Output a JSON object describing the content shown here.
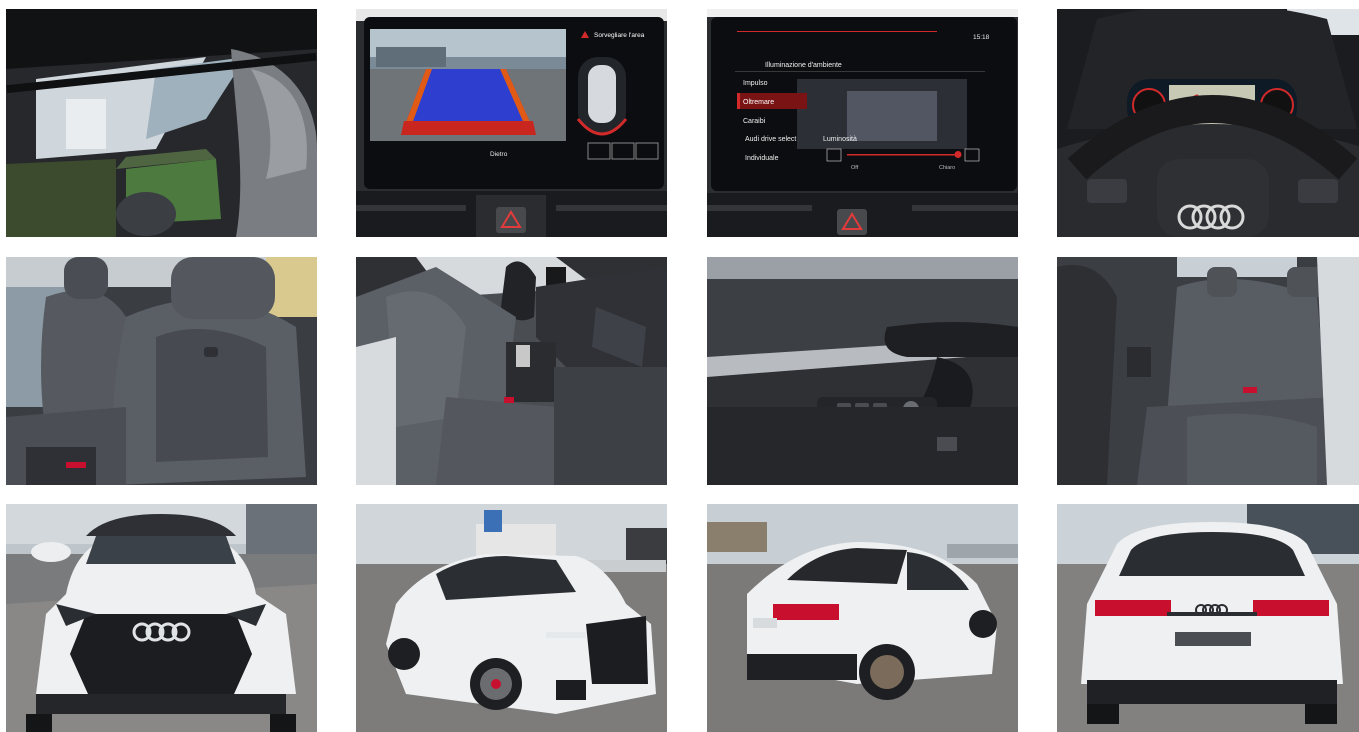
{
  "gallery": {
    "photos": [
      {
        "subject": "panoramic-sunroof-interior"
      },
      {
        "subject": "rear-camera-display",
        "screen": {
          "warning": "Sorvegliare l'area",
          "view": "Dietro"
        }
      },
      {
        "subject": "ambient-lighting-menu",
        "screen": {
          "clock": "15:18",
          "title": "Illuminazione d'ambiente",
          "items": [
            "Impulso",
            "Oltremare",
            "Caraibi",
            "Audi drive select",
            "Individuale"
          ],
          "selected": "Oltremare",
          "brightness_label": "Luminosità",
          "brightness_min": "Off",
          "brightness_max": "Chiaro",
          "brightness_level": 0.9
        }
      },
      {
        "subject": "steering-wheel-virtual-cockpit"
      },
      {
        "subject": "front-sport-seats"
      },
      {
        "subject": "dashboard-from-passenger-door"
      },
      {
        "subject": "door-panel-window-controls"
      },
      {
        "subject": "rear-bench-seats"
      },
      {
        "subject": "exterior-front"
      },
      {
        "subject": "exterior-front-three-quarter"
      },
      {
        "subject": "exterior-rear-three-quarter"
      },
      {
        "subject": "exterior-rear"
      }
    ]
  },
  "colors": {
    "car_white": "#eef0f2",
    "grille_black": "#1b1d21",
    "leather_grey": "#4f5358",
    "taillight_red": "#c8102e",
    "screen_black": "#0c0d10",
    "accent_red": "#d22a2a"
  }
}
